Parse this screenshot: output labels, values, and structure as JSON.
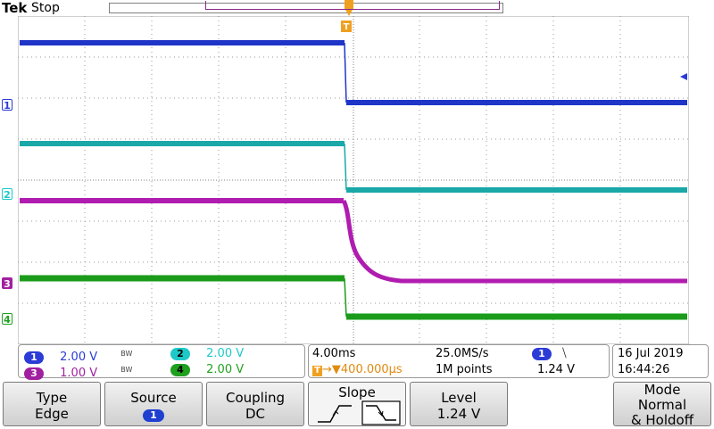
{
  "header": {
    "brand": "Tek",
    "state": "Stop"
  },
  "channel_markers": [
    {
      "label": "1",
      "color": "#2a3bd6"
    },
    {
      "label": "2",
      "color": "#1ec8c8"
    },
    {
      "label": "3",
      "color": "#a020a0"
    },
    {
      "label": "4",
      "color": "#1fa01f"
    }
  ],
  "trigger_marker": "T",
  "vertical_settings": [
    {
      "channel": "1",
      "scale": "2.00 V",
      "bw": "BW",
      "color": "#2a3bd6",
      "text_color": "#2a3bd6"
    },
    {
      "channel": "2",
      "scale": "2.00 V",
      "bw": "",
      "color": "#1ec8c8",
      "text_color": "#1ec8c8"
    },
    {
      "channel": "3",
      "scale": "1.00 V",
      "bw": "BW",
      "color": "#a020a0",
      "text_color": "#a020a0"
    },
    {
      "channel": "4",
      "scale": "2.00 V",
      "bw": "",
      "color": "#1fa01f",
      "text_color": "#1fa01f"
    }
  ],
  "timebase": {
    "scale": "4.00ms",
    "sample_rate": "25.0MS/s",
    "delay": "▼400.000µs",
    "record_length": "1M points",
    "trigger_source": "1",
    "trigger_slope_symbol": "⧹",
    "trigger_level": "1.24 V"
  },
  "datetime": {
    "date": "16 Jul  2019",
    "time": "16:44:26"
  },
  "softkeys": {
    "type": {
      "title": "Type",
      "value": "Edge"
    },
    "source": {
      "title": "Source",
      "value": "1"
    },
    "coupling": {
      "title": "Coupling",
      "value": "DC"
    },
    "slope": {
      "title": "Slope"
    },
    "level": {
      "title": "Level",
      "value": "1.24 V"
    },
    "mode": {
      "title": "Mode",
      "line1": "Normal",
      "line2": "& Holdoff"
    }
  }
}
